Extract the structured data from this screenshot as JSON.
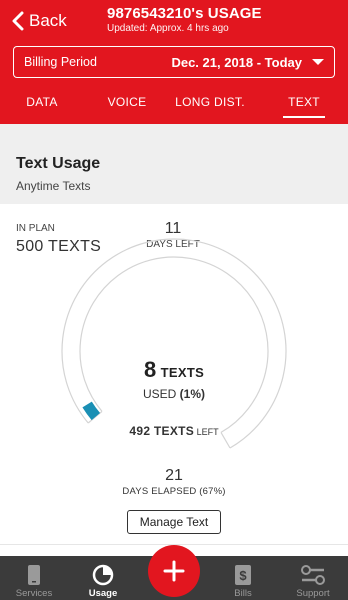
{
  "header": {
    "back_label": "Back",
    "title": "9876543210's USAGE",
    "subtitle": "Updated: Approx. 4 hrs ago",
    "bg_color": "#e2161f"
  },
  "billing": {
    "label": "Billing Period",
    "value": "Dec. 21, 2018 - Today"
  },
  "tabs": [
    {
      "label": "DATA",
      "active": false
    },
    {
      "label": "VOICE",
      "active": false
    },
    {
      "label": "LONG DIST.",
      "active": false
    },
    {
      "label": "TEXT",
      "active": true
    }
  ],
  "section": {
    "title": "Text Usage",
    "subtitle": "Anytime Texts"
  },
  "plan": {
    "label": "IN PLAN",
    "value": "500 TEXTS"
  },
  "days_left": {
    "number": "11",
    "label": "DAYS LEFT"
  },
  "usage": {
    "used_number": "8",
    "used_unit": "TEXTS",
    "used_prefix": "USED ",
    "used_percent": "(1%)",
    "used_fraction": 0.016,
    "left_value": "492 TEXTS",
    "left_suffix": " LEFT",
    "accent_color": "#1a8fb4"
  },
  "elapsed": {
    "number": "21",
    "label": "DAYS ELAPSED (67%)",
    "fraction": 0.67
  },
  "manage_button": "Manage Text",
  "tabbar": {
    "items": [
      {
        "label": "Services",
        "icon": "phone-icon",
        "active": false
      },
      {
        "label": "Usage",
        "icon": "pie-chart-icon",
        "active": true
      },
      {
        "label": "Bills",
        "icon": "dollar-document-icon",
        "active": false
      },
      {
        "label": "Support",
        "icon": "wrench-icon",
        "active": false
      }
    ],
    "fab_icon": "plus-icon"
  }
}
